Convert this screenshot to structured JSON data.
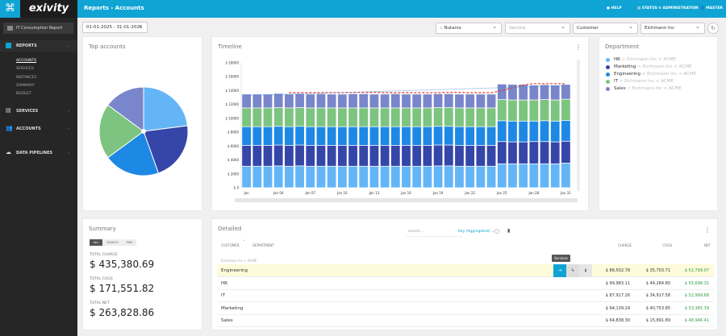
{
  "app": {
    "brand": "exivity",
    "report_select": "IT Consumption Report"
  },
  "topbar": {
    "breadcrumb": "Reports › Accounts",
    "help": "HELP",
    "status": "STATUS",
    "administration": "ADMINISTRATION",
    "user": "MASTER"
  },
  "sidebar": {
    "items": [
      {
        "label": "REPORTS",
        "sub": [
          "ACCOUNTS",
          "SERVICES",
          "INSTANCES",
          "SUMMARY",
          "BUDGET"
        ]
      },
      {
        "label": "SERVICES"
      },
      {
        "label": "ACCOUNTS"
      },
      {
        "label": "DATA PIPELINES"
      }
    ]
  },
  "filters": {
    "date_range": "01-01-2025 - 31-01-2025",
    "datasource": ":: Nutanix",
    "service_placeholder": "Service",
    "level": "Customer",
    "account": "Eichmann Inc"
  },
  "top_accounts": {
    "title": "Top accounts"
  },
  "timeline": {
    "title": "Timeline"
  },
  "department": {
    "title": "Department",
    "items": [
      {
        "name": "HR",
        "path": "< Eichmann Inc < ACME",
        "color": "#64b5f6"
      },
      {
        "name": "Marketing",
        "path": "< Eichmann Inc < ACME",
        "color": "#3545a8"
      },
      {
        "name": "Engineering",
        "path": "< Eichmann Inc < ACME",
        "color": "#1e88e5"
      },
      {
        "name": "IT",
        "path": "< Eichmann Inc < ACME",
        "color": "#7cc47f"
      },
      {
        "name": "Sales",
        "path": "< Eichmann Inc < ACME",
        "color": "#7986cb"
      }
    ]
  },
  "summary": {
    "title": "Summary",
    "tabs": [
      "ALL",
      "SEARCH",
      "PINS"
    ],
    "total_charge_label": "TOTAL CHARGE",
    "total_charge": "$ 435,380.69",
    "total_cogs_label": "TOTAL COGS",
    "total_cogs": "$ 171,551.82",
    "total_net_label": "TOTAL NET",
    "total_net": "$ 263,828.86"
  },
  "detailed": {
    "title": "Detailed",
    "search_placeholder": "search...",
    "key_select": "Key (Aggregated)",
    "columns": {
      "customer": "CUSTOMER",
      "department": "DEPARTMENT",
      "charge": "CHARGE",
      "cogs": "COGS",
      "net": "NET"
    },
    "group": "Eichmann Inc < ACME",
    "tooltip": "Services",
    "rows": [
      {
        "name": "Engineering",
        "charge": "$ 88,502.78",
        "cogs": "$ 35,703.71",
        "net": "$ 52,799.07"
      },
      {
        "name": "HR",
        "charge": "$ 99,983.11",
        "cogs": "$ 44,284.80",
        "net": "$ 55,698.31"
      },
      {
        "name": "IT",
        "charge": "$ 87,917.26",
        "cogs": "$ 34,917.58",
        "net": "$ 52,999.68"
      },
      {
        "name": "Marketing",
        "charge": "$ 94,139.24",
        "cogs": "$ 40,753.85",
        "net": "$ 53,385.39"
      },
      {
        "name": "Sales",
        "charge": "$ 64,838.30",
        "cogs": "$ 15,891.89",
        "net": "$ 48,946.41"
      }
    ]
  },
  "chart_data": [
    {
      "type": "pie",
      "labels": [
        "HR",
        "Marketing",
        "Engineering",
        "IT",
        "Sales"
      ],
      "values": [
        99983.11,
        94139.24,
        88502.78,
        87917.26,
        64838.3
      ],
      "colors": [
        "#64b5f6",
        "#3545a8",
        "#1e88e5",
        "#7cc47f",
        "#7986cb"
      ]
    },
    {
      "type": "bar",
      "stacked": true,
      "ylim": [
        0,
        18000
      ],
      "yticks": [
        "$ 0",
        "$ 2000",
        "$ 4000",
        "$ 6000",
        "$ 8000",
        "$ 10000",
        "$ 12000",
        "$ 14000",
        "$ 16000",
        "$ 18000"
      ],
      "xticks": [
        "Jan",
        "Jan 04",
        "Jan 07",
        "Jan 10",
        "Jan 13",
        "Jan 16",
        "Jan 19",
        "Jan 22",
        "Jan 25",
        "Jan 28",
        "Jan 31"
      ],
      "days": 31,
      "series": [
        {
          "name": "HR",
          "color": "#64b5f6",
          "values": [
            3100,
            3100,
            3100,
            3150,
            3100,
            3150,
            3100,
            3100,
            3100,
            3100,
            3100,
            3100,
            3100,
            3100,
            3100,
            3100,
            3100,
            3100,
            3150,
            3150,
            3100,
            3100,
            3100,
            3100,
            3450,
            3450,
            3450,
            3450,
            3450,
            3450,
            3550
          ]
        },
        {
          "name": "Marketing",
          "color": "#3545a8",
          "values": [
            3000,
            3000,
            3000,
            3000,
            3000,
            3000,
            3000,
            3000,
            3000,
            3000,
            3000,
            3000,
            3000,
            3000,
            3000,
            3000,
            3000,
            3000,
            3000,
            3000,
            3000,
            3000,
            3000,
            3000,
            3200,
            3150,
            3150,
            3200,
            3200,
            3150,
            3150
          ]
        },
        {
          "name": "Engineering",
          "color": "#1e88e5",
          "values": [
            2700,
            2700,
            2700,
            2700,
            2700,
            2700,
            2700,
            2700,
            2700,
            2700,
            2700,
            2700,
            2700,
            2700,
            2700,
            2700,
            2700,
            2700,
            2700,
            2700,
            2700,
            2700,
            2700,
            2700,
            3000,
            3000,
            3000,
            2950,
            3000,
            3000,
            3000
          ]
        },
        {
          "name": "IT",
          "color": "#7cc47f",
          "values": [
            2700,
            2700,
            2700,
            2700,
            2700,
            2700,
            2700,
            2700,
            2700,
            2700,
            2700,
            2700,
            2700,
            2700,
            2700,
            2700,
            2700,
            2700,
            2700,
            2700,
            2700,
            2700,
            2700,
            2700,
            3050,
            3050,
            3050,
            3050,
            3050,
            3050,
            3050
          ]
        },
        {
          "name": "Sales",
          "color": "#7986cb",
          "values": [
            2000,
            2000,
            2000,
            2050,
            2000,
            2000,
            2000,
            2050,
            2000,
            2000,
            2050,
            2050,
            2000,
            2000,
            2050,
            2000,
            2000,
            2000,
            2000,
            2000,
            2000,
            2000,
            2000,
            2000,
            2250,
            2250,
            2250,
            2150,
            2150,
            2150,
            2150
          ]
        }
      ],
      "lines": [
        {
          "style": "dashed",
          "color": "#e53935",
          "values": [
            null,
            null,
            null,
            null,
            13700,
            13700,
            13700,
            13700,
            13700,
            13700,
            13750,
            13750,
            13750,
            13700,
            13700,
            13700,
            13700,
            13700,
            13700,
            13750,
            13750,
            13700,
            13700,
            13700,
            14000,
            14400,
            14800,
            15000,
            15000,
            15000,
            15000
          ]
        },
        {
          "style": "dotted",
          "color": "#4a90d9",
          "values": [
            13300,
            null,
            null,
            null,
            null,
            null,
            null,
            null,
            null,
            null,
            null,
            null,
            null,
            null,
            null,
            null,
            null,
            null,
            null,
            null,
            null,
            null,
            null,
            null,
            null,
            null,
            null,
            null,
            null,
            null,
            14700
          ]
        }
      ]
    }
  ]
}
